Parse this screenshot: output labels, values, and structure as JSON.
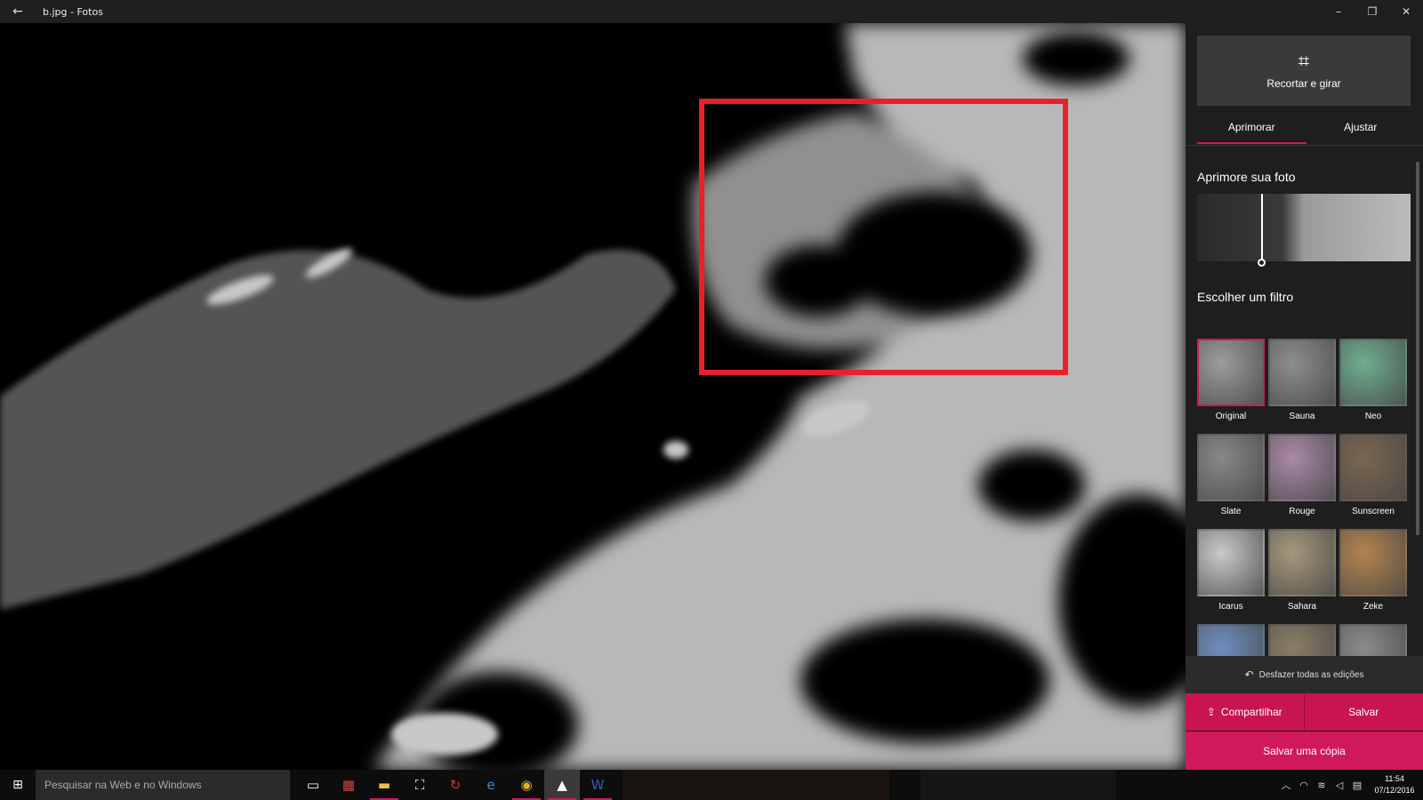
{
  "window": {
    "title": "b.jpg - Fotos",
    "back_icon": "←",
    "minimize_icon": "–",
    "restore_icon": "❐",
    "close_icon": "✕"
  },
  "panel": {
    "crop_button_label": "Recortar e girar",
    "crop_icon": "⌗",
    "tabs": [
      "Aprimorar",
      "Ajustar"
    ],
    "active_tab": "Aprimorar",
    "enhance_title": "Aprimore sua foto",
    "enhance_level": 0.3,
    "filter_title": "Escolher um filtro",
    "filters": [
      {
        "name": "Original",
        "color": "#9c9c9c",
        "selected": true
      },
      {
        "name": "Sauna",
        "color": "#8e8e8e",
        "selected": false
      },
      {
        "name": "Neo",
        "color": "#6fae8f",
        "selected": false
      },
      {
        "name": "Slate",
        "color": "#888888",
        "selected": false
      },
      {
        "name": "Rouge",
        "color": "#a98aa6",
        "selected": false
      },
      {
        "name": "Sunscreen",
        "color": "#7a6650",
        "selected": false
      },
      {
        "name": "Icarus",
        "color": "#c9c9c9",
        "selected": false
      },
      {
        "name": "Sahara",
        "color": "#a6987c",
        "selected": false
      },
      {
        "name": "Zeke",
        "color": "#b3844f",
        "selected": false
      },
      {
        "name": "",
        "color": "#6f8fbf",
        "selected": false
      },
      {
        "name": "",
        "color": "#8a7f66",
        "selected": false
      },
      {
        "name": "",
        "color": "#8c8c8c",
        "selected": false
      }
    ],
    "undo_label": "Desfazer todas as edições",
    "undo_icon": "↶",
    "share_label": "Compartilhar",
    "share_icon": "⇪",
    "save_label": "Salvar",
    "save_copy_label": "Salvar uma cópia"
  },
  "taskbar": {
    "start_icon": "⊞",
    "search_placeholder": "Pesquisar na Web e no Windows",
    "icons": [
      {
        "name": "task-view-icon",
        "glyph": "▭",
        "running": false,
        "active": false,
        "color": "#ffffff"
      },
      {
        "name": "app-red-icon",
        "glyph": "▦",
        "running": false,
        "active": false,
        "color": "#e04040"
      },
      {
        "name": "file-explorer-icon",
        "glyph": "▬",
        "running": true,
        "active": false,
        "color": "#f0c040"
      },
      {
        "name": "store-icon",
        "glyph": "⛶",
        "running": false,
        "active": false,
        "color": "#ffffff"
      },
      {
        "name": "sync-icon",
        "glyph": "↻",
        "running": false,
        "active": false,
        "color": "#e03030"
      },
      {
        "name": "edge-icon",
        "glyph": "e",
        "running": false,
        "active": false,
        "color": "#2f8fe0"
      },
      {
        "name": "chrome-icon",
        "glyph": "◉",
        "running": true,
        "active": false,
        "color": "#e0b030"
      },
      {
        "name": "photos-icon",
        "glyph": "▲",
        "running": true,
        "active": true,
        "color": "#ffffff"
      },
      {
        "name": "word-icon",
        "glyph": "W",
        "running": true,
        "active": false,
        "color": "#2b5fb3"
      }
    ],
    "time": "11:54",
    "date": "07/12/2016"
  }
}
